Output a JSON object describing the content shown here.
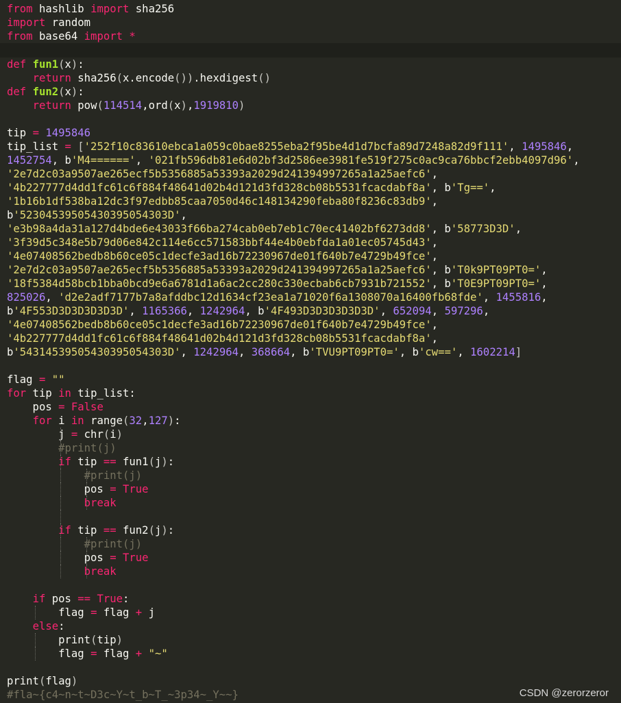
{
  "theme": {
    "background": "#272822",
    "keyword": "#f92672",
    "function": "#a6e22e",
    "number": "#ae81ff",
    "string": "#e6db74",
    "comment": "#75715e",
    "text": "#f8f8f2"
  },
  "editor": {
    "lines": [
      {
        "tokens": [
          [
            "kw",
            "from"
          ],
          [
            "t",
            " hashlib "
          ],
          [
            "kw",
            "import"
          ],
          [
            "t",
            " sha256"
          ]
        ]
      },
      {
        "tokens": [
          [
            "kw",
            "import"
          ],
          [
            "t",
            " random"
          ]
        ]
      },
      {
        "tokens": [
          [
            "kw",
            "from"
          ],
          [
            "t",
            " base64 "
          ],
          [
            "kw",
            "import"
          ],
          [
            "t",
            " "
          ],
          [
            "op",
            "*"
          ]
        ]
      },
      {
        "current": true,
        "tokens": []
      },
      {
        "tokens": [
          [
            "kw",
            "def"
          ],
          [
            "t",
            " "
          ],
          [
            "fn",
            "fun1"
          ],
          [
            "p",
            "("
          ],
          [
            "t",
            "x"
          ],
          [
            "p",
            ")"
          ],
          [
            "t",
            ":"
          ]
        ]
      },
      {
        "tokens": [
          [
            "t",
            "    "
          ],
          [
            "kw",
            "return"
          ],
          [
            "t",
            " sha256"
          ],
          [
            "p",
            "("
          ],
          [
            "t",
            "x.encode"
          ],
          [
            "p",
            "()"
          ],
          [
            "p",
            ")"
          ],
          [
            "t",
            ".hexdigest"
          ],
          [
            "p",
            "()"
          ]
        ]
      },
      {
        "tokens": [
          [
            "kw",
            "def"
          ],
          [
            "t",
            " "
          ],
          [
            "fn",
            "fun2"
          ],
          [
            "p",
            "("
          ],
          [
            "t",
            "x"
          ],
          [
            "p",
            ")"
          ],
          [
            "t",
            ":"
          ]
        ]
      },
      {
        "tokens": [
          [
            "t",
            "    "
          ],
          [
            "kw",
            "return"
          ],
          [
            "t",
            " pow"
          ],
          [
            "p",
            "("
          ],
          [
            "num",
            "114514"
          ],
          [
            "t",
            ",ord"
          ],
          [
            "p",
            "("
          ],
          [
            "t",
            "x"
          ],
          [
            "p",
            ")"
          ],
          [
            "t",
            ","
          ],
          [
            "num",
            "1919810"
          ],
          [
            "p",
            ")"
          ]
        ]
      },
      {
        "tokens": []
      },
      {
        "tokens": [
          [
            "t",
            "tip "
          ],
          [
            "op",
            "="
          ],
          [
            "t",
            " "
          ],
          [
            "num",
            "1495846"
          ]
        ]
      },
      {
        "tokens": [
          [
            "t",
            "tip_list "
          ],
          [
            "op",
            "="
          ],
          [
            "t",
            " "
          ],
          [
            "p",
            "["
          ],
          [
            "str",
            "'252f10c83610ebca1a059c0bae8255eba2f95be4d1d7bcfa89d7248a82d9f111'"
          ],
          [
            "t",
            ", "
          ],
          [
            "num",
            "1495846"
          ],
          [
            "t",
            ","
          ]
        ]
      },
      {
        "tokens": [
          [
            "num",
            "1452754"
          ],
          [
            "t",
            ", b"
          ],
          [
            "str",
            "'M4======'"
          ],
          [
            "t",
            ", "
          ],
          [
            "str",
            "'021fb596db81e6d02bf3d2586ee3981fe519f275c0ac9ca76bbcf2ebb4097d96'"
          ],
          [
            "t",
            ","
          ]
        ]
      },
      {
        "tokens": [
          [
            "str",
            "'2e7d2c03a9507ae265ecf5b5356885a53393a2029d241394997265a1a25aefc6'"
          ],
          [
            "t",
            ","
          ]
        ]
      },
      {
        "tokens": [
          [
            "str",
            "'4b227777d4dd1fc61c6f884f48641d02b4d121d3fd328cb08b5531fcacdabf8a'"
          ],
          [
            "t",
            ", b"
          ],
          [
            "str",
            "'Tg=='"
          ],
          [
            "t",
            ","
          ]
        ]
      },
      {
        "tokens": [
          [
            "str",
            "'1b16b1df538ba12dc3f97edbb85caa7050d46c148134290feba80f8236c83db9'"
          ],
          [
            "t",
            ","
          ]
        ]
      },
      {
        "tokens": [
          [
            "t",
            "b"
          ],
          [
            "str",
            "'52304539505430395054303D'"
          ],
          [
            "t",
            ","
          ]
        ]
      },
      {
        "tokens": [
          [
            "str",
            "'e3b98a4da31a127d4bde6e43033f66ba274cab0eb7eb1c70ec41402bf6273dd8'"
          ],
          [
            "t",
            ", b"
          ],
          [
            "str",
            "'58773D3D'"
          ],
          [
            "t",
            ","
          ]
        ]
      },
      {
        "tokens": [
          [
            "str",
            "'3f39d5c348e5b79d06e842c114e6cc571583bbf44e4b0ebfda1a01ec05745d43'"
          ],
          [
            "t",
            ","
          ]
        ]
      },
      {
        "tokens": [
          [
            "str",
            "'4e07408562bedb8b60ce05c1decfe3ad16b72230967de01f640b7e4729b49fce'"
          ],
          [
            "t",
            ","
          ]
        ]
      },
      {
        "tokens": [
          [
            "str",
            "'2e7d2c03a9507ae265ecf5b5356885a53393a2029d241394997265a1a25aefc6'"
          ],
          [
            "t",
            ", b"
          ],
          [
            "str",
            "'T0k9PT09PT0='"
          ],
          [
            "t",
            ","
          ]
        ]
      },
      {
        "tokens": [
          [
            "str",
            "'18f5384d58bcb1bba0bcd9e6a6781d1a6ac2cc280c330ecbab6cb7931b721552'"
          ],
          [
            "t",
            ", b"
          ],
          [
            "str",
            "'T0E9PT09PT0='"
          ],
          [
            "t",
            ","
          ]
        ]
      },
      {
        "tokens": [
          [
            "num",
            "825026"
          ],
          [
            "t",
            ", "
          ],
          [
            "str",
            "'d2e2adf7177b7a8afddbc12d1634cf23ea1a71020f6a1308070a16400fb68fde'"
          ],
          [
            "t",
            ", "
          ],
          [
            "num",
            "1455816"
          ],
          [
            "t",
            ","
          ]
        ]
      },
      {
        "tokens": [
          [
            "t",
            "b"
          ],
          [
            "str",
            "'4F553D3D3D3D3D3D'"
          ],
          [
            "t",
            ", "
          ],
          [
            "num",
            "1165366"
          ],
          [
            "t",
            ", "
          ],
          [
            "num",
            "1242964"
          ],
          [
            "t",
            ", b"
          ],
          [
            "str",
            "'4F493D3D3D3D3D3D'"
          ],
          [
            "t",
            ", "
          ],
          [
            "num",
            "652094"
          ],
          [
            "t",
            ", "
          ],
          [
            "num",
            "597296"
          ],
          [
            "t",
            ","
          ]
        ]
      },
      {
        "tokens": [
          [
            "str",
            "'4e07408562bedb8b60ce05c1decfe3ad16b72230967de01f640b7e4729b49fce'"
          ],
          [
            "t",
            ","
          ]
        ]
      },
      {
        "tokens": [
          [
            "str",
            "'4b227777d4dd1fc61c6f884f48641d02b4d121d3fd328cb08b5531fcacdabf8a'"
          ],
          [
            "t",
            ","
          ]
        ]
      },
      {
        "tokens": [
          [
            "t",
            "b"
          ],
          [
            "str",
            "'54314539505430395054303D'"
          ],
          [
            "t",
            ", "
          ],
          [
            "num",
            "1242964"
          ],
          [
            "t",
            ", "
          ],
          [
            "num",
            "368664"
          ],
          [
            "t",
            ", b"
          ],
          [
            "str",
            "'TVU9PT09PT0='"
          ],
          [
            "t",
            ", b"
          ],
          [
            "str",
            "'cw=='"
          ],
          [
            "t",
            ", "
          ],
          [
            "num",
            "1602214"
          ],
          [
            "p",
            "]"
          ]
        ]
      },
      {
        "tokens": []
      },
      {
        "tokens": [
          [
            "t",
            "flag "
          ],
          [
            "op",
            "="
          ],
          [
            "t",
            " "
          ],
          [
            "str",
            "\"\""
          ]
        ]
      },
      {
        "tokens": [
          [
            "kw",
            "for"
          ],
          [
            "t",
            " tip "
          ],
          [
            "kw",
            "in"
          ],
          [
            "t",
            " tip_list:"
          ]
        ]
      },
      {
        "tokens": [
          [
            "t",
            "    pos "
          ],
          [
            "op",
            "="
          ],
          [
            "t",
            " "
          ],
          [
            "kw",
            "False"
          ]
        ]
      },
      {
        "tokens": [
          [
            "t",
            "    "
          ],
          [
            "kw",
            "for"
          ],
          [
            "t",
            " i "
          ],
          [
            "kw",
            "in"
          ],
          [
            "t",
            " range"
          ],
          [
            "p",
            "("
          ],
          [
            "num",
            "32"
          ],
          [
            "t",
            ","
          ],
          [
            "num",
            "127"
          ],
          [
            "p",
            ")"
          ],
          [
            "t",
            ":"
          ]
        ]
      },
      {
        "guides": [
          1
        ],
        "tokens": [
          [
            "t",
            "        j "
          ],
          [
            "op",
            "="
          ],
          [
            "t",
            " chr"
          ],
          [
            "p",
            "("
          ],
          [
            "t",
            "i"
          ],
          [
            "p",
            ")"
          ]
        ]
      },
      {
        "guides": [
          1
        ],
        "tokens": [
          [
            "t",
            "        "
          ],
          [
            "cm",
            "#print(j)"
          ]
        ]
      },
      {
        "guides": [
          1
        ],
        "tokens": [
          [
            "t",
            "        "
          ],
          [
            "kw",
            "if"
          ],
          [
            "t",
            " tip "
          ],
          [
            "op",
            "=="
          ],
          [
            "t",
            " fun1"
          ],
          [
            "p",
            "("
          ],
          [
            "t",
            "j"
          ],
          [
            "p",
            ")"
          ],
          [
            "t",
            ":"
          ]
        ]
      },
      {
        "guides": [
          1,
          2
        ],
        "tokens": [
          [
            "t",
            "            "
          ],
          [
            "cm",
            "#print(j)"
          ]
        ]
      },
      {
        "guides": [
          1,
          2
        ],
        "tokens": [
          [
            "t",
            "            pos "
          ],
          [
            "op",
            "="
          ],
          [
            "t",
            " "
          ],
          [
            "kw",
            "True"
          ]
        ]
      },
      {
        "guides": [
          1,
          2
        ],
        "tokens": [
          [
            "t",
            "            "
          ],
          [
            "kw",
            "break"
          ]
        ]
      },
      {
        "guides": [
          1
        ],
        "tokens": []
      },
      {
        "guides": [
          1
        ],
        "tokens": [
          [
            "t",
            "        "
          ],
          [
            "kw",
            "if"
          ],
          [
            "t",
            " tip "
          ],
          [
            "op",
            "=="
          ],
          [
            "t",
            " fun2"
          ],
          [
            "p",
            "("
          ],
          [
            "t",
            "j"
          ],
          [
            "p",
            ")"
          ],
          [
            "t",
            ":"
          ]
        ]
      },
      {
        "guides": [
          1,
          2
        ],
        "tokens": [
          [
            "t",
            "            "
          ],
          [
            "cm",
            "#print(j)"
          ]
        ]
      },
      {
        "guides": [
          1,
          2
        ],
        "tokens": [
          [
            "t",
            "            pos "
          ],
          [
            "op",
            "="
          ],
          [
            "t",
            " "
          ],
          [
            "kw",
            "True"
          ]
        ]
      },
      {
        "guides": [
          1,
          2
        ],
        "tokens": [
          [
            "t",
            "            "
          ],
          [
            "kw",
            "break"
          ]
        ]
      },
      {
        "tokens": []
      },
      {
        "tokens": [
          [
            "t",
            "    "
          ],
          [
            "kw",
            "if"
          ],
          [
            "t",
            " pos "
          ],
          [
            "op",
            "=="
          ],
          [
            "t",
            " "
          ],
          [
            "kw",
            "True"
          ],
          [
            "t",
            ":"
          ]
        ]
      },
      {
        "guides": [
          0
        ],
        "tokens": [
          [
            "t",
            "        flag "
          ],
          [
            "op",
            "="
          ],
          [
            "t",
            " flag "
          ],
          [
            "op",
            "+"
          ],
          [
            "t",
            " j"
          ]
        ]
      },
      {
        "tokens": [
          [
            "t",
            "    "
          ],
          [
            "kw",
            "else"
          ],
          [
            "t",
            ":"
          ]
        ]
      },
      {
        "guides": [
          0
        ],
        "tokens": [
          [
            "t",
            "        print"
          ],
          [
            "p",
            "("
          ],
          [
            "t",
            "tip"
          ],
          [
            "p",
            ")"
          ]
        ]
      },
      {
        "guides": [
          0
        ],
        "tokens": [
          [
            "t",
            "        flag "
          ],
          [
            "op",
            "="
          ],
          [
            "t",
            " flag "
          ],
          [
            "op",
            "+"
          ],
          [
            "t",
            " "
          ],
          [
            "str",
            "\"~\""
          ]
        ]
      },
      {
        "tokens": []
      },
      {
        "tokens": [
          [
            "t",
            "print"
          ],
          [
            "p",
            "("
          ],
          [
            "t",
            "flag"
          ],
          [
            "p",
            ")"
          ]
        ]
      },
      {
        "tokens": [
          [
            "cm",
            "#fla~{c4~n~t~D3c~Y~t_b~T_~3p34~_Y~~}"
          ]
        ]
      }
    ]
  },
  "watermark": {
    "text": "CSDN @zerorzeror"
  }
}
